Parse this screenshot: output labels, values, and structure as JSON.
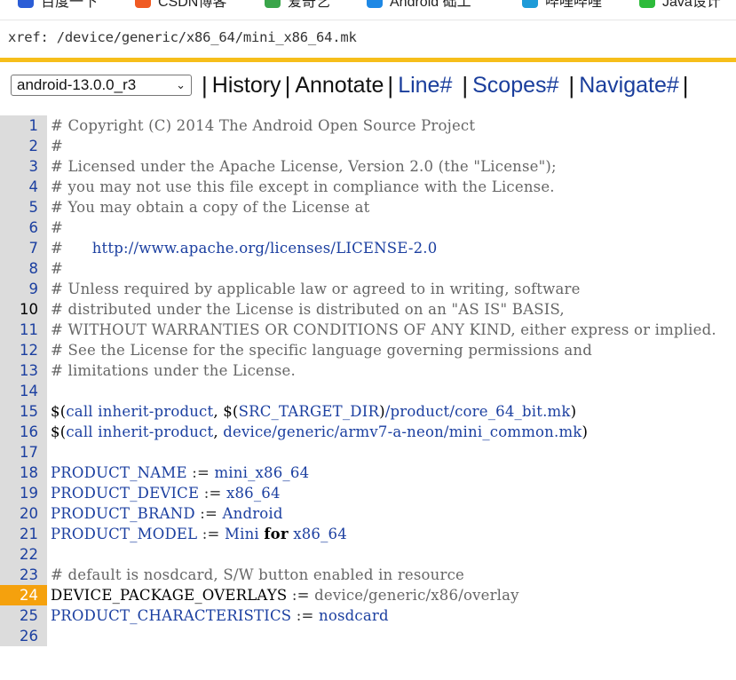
{
  "bookmarks": [
    {
      "label": "百度一下",
      "icon": "baidu-icon",
      "color": "#2b5dd6"
    },
    {
      "label": "CSDN博客",
      "icon": "csdn-icon",
      "color": "#f05a22"
    },
    {
      "label": "爱奇艺",
      "icon": "iqiyi-icon",
      "color": "#3aa54a"
    },
    {
      "label": "Android 础工",
      "icon": "android-diamond-icon",
      "color": "#1e88e5"
    },
    {
      "label": "哔哩哔哩",
      "icon": "bilibili-icon",
      "color": "#1e9bd8"
    },
    {
      "label": "Java设计",
      "icon": "wechat-icon",
      "color": "#2dbb3a"
    }
  ],
  "xref_path": "xref: /device/generic/x86_64/mini_x86_64.mk",
  "toolbar": {
    "branch_select": "android-13.0.0_r3",
    "history": "History",
    "annotate": "Annotate",
    "line": "Line#",
    "scopes": "Scopes#",
    "navigate": "Navigate#",
    "separator": "|"
  },
  "highlight_line": "24",
  "emphasized_line": "10",
  "colors": {
    "accent": "#f6be1a",
    "line_highlight": "#f5a10d",
    "selection": "#3d83e0",
    "link": "#1a3e9c"
  },
  "lines": [
    {
      "n": "1",
      "parts": [
        {
          "t": "# Copyright (C) 2014 The Android Open Source Project",
          "c": "com"
        }
      ]
    },
    {
      "n": "2",
      "parts": [
        {
          "t": "#",
          "c": "com"
        }
      ]
    },
    {
      "n": "3",
      "parts": [
        {
          "t": "# Licensed under the Apache License, Version 2.0 (the \"License\");",
          "c": "com"
        }
      ]
    },
    {
      "n": "4",
      "parts": [
        {
          "t": "# you may not use this file except in compliance with the License.",
          "c": "com"
        }
      ]
    },
    {
      "n": "5",
      "parts": [
        {
          "t": "# You may obtain a copy of the License at",
          "c": "com"
        }
      ]
    },
    {
      "n": "6",
      "parts": [
        {
          "t": "#",
          "c": "com"
        }
      ]
    },
    {
      "n": "7",
      "parts": [
        {
          "t": "#      ",
          "c": "com"
        },
        {
          "t": "http://www.apache.org/licenses/LICENSE-2.0",
          "c": "url"
        }
      ]
    },
    {
      "n": "8",
      "parts": [
        {
          "t": "#",
          "c": "com"
        }
      ]
    },
    {
      "n": "9",
      "parts": [
        {
          "t": "# Unless required by applicable law or agreed to in writing, software",
          "c": "com"
        }
      ]
    },
    {
      "n": "10",
      "parts": [
        {
          "t": "# distributed under the License is distributed on an \"AS IS\" BASIS,",
          "c": "com"
        }
      ]
    },
    {
      "n": "11",
      "parts": [
        {
          "t": "# WITHOUT WARRANTIES OR CONDITIONS OF ANY KIND, either express or implied.",
          "c": "com"
        }
      ]
    },
    {
      "n": "12",
      "parts": [
        {
          "t": "# See the License for the specific language governing permissions and",
          "c": "com"
        }
      ]
    },
    {
      "n": "13",
      "parts": [
        {
          "t": "# limitations under the License.",
          "c": "com"
        }
      ]
    },
    {
      "n": "14",
      "parts": []
    },
    {
      "n": "15",
      "parts": [
        {
          "t": "$(",
          "c": "black"
        },
        {
          "t": "call inherit-product",
          "c": "var"
        },
        {
          "t": ", $(",
          "c": "black"
        },
        {
          "t": "SRC_TARGET_DIR",
          "c": "var"
        },
        {
          "t": ")",
          "c": "black"
        },
        {
          "t": "/product/core_64_bit.mk",
          "c": "txt"
        },
        {
          "t": ")",
          "c": "black"
        }
      ]
    },
    {
      "n": "16",
      "parts": [
        {
          "t": "$(",
          "c": "black"
        },
        {
          "t": "call inherit-product",
          "c": "var"
        },
        {
          "t": ", ",
          "c": "black"
        },
        {
          "t": "device/generic/armv7-a-neon/mini_common.mk",
          "c": "txt"
        },
        {
          "t": ")",
          "c": "black"
        }
      ]
    },
    {
      "n": "17",
      "parts": []
    },
    {
      "n": "18",
      "parts": [
        {
          "t": "PRODUCT_NAME",
          "c": "var"
        },
        {
          "t": " := ",
          "c": "op"
        },
        {
          "t": "mini_x86_64",
          "c": "txt"
        }
      ]
    },
    {
      "n": "19",
      "parts": [
        {
          "t": "PRODUCT_DEVICE",
          "c": "var"
        },
        {
          "t": " := ",
          "c": "op"
        },
        {
          "t": "x86_64",
          "c": "txt"
        }
      ]
    },
    {
      "n": "20",
      "parts": [
        {
          "t": "PRODUCT_BRAND",
          "c": "var"
        },
        {
          "t": " := ",
          "c": "op"
        },
        {
          "t": "Android",
          "c": "txt"
        }
      ]
    },
    {
      "n": "21",
      "parts": [
        {
          "t": "PRODUCT_MODEL",
          "c": "var"
        },
        {
          "t": " := ",
          "c": "op"
        },
        {
          "t": "Mini ",
          "c": "txt"
        },
        {
          "t": "for",
          "c": "kw"
        },
        {
          "t": " x86_64",
          "c": "txt"
        }
      ]
    },
    {
      "n": "22",
      "parts": []
    },
    {
      "n": "23",
      "parts": [
        {
          "t": "# default is nosdcard, S/W button enabled in resource",
          "c": "com"
        }
      ]
    },
    {
      "n": "24",
      "parts": [
        {
          "t": "DEVICE_PACKAGE_OVERLAYS",
          "c": "black"
        },
        {
          "t": " := ",
          "c": "op"
        },
        {
          "t": "device/generic/x86/overlay",
          "c": "sel"
        }
      ]
    },
    {
      "n": "25",
      "parts": [
        {
          "t": "PRODUCT_CHARACTERISTICS",
          "c": "var"
        },
        {
          "t": " := ",
          "c": "op"
        },
        {
          "t": "nosdcard",
          "c": "txt"
        }
      ]
    },
    {
      "n": "26",
      "parts": []
    }
  ]
}
